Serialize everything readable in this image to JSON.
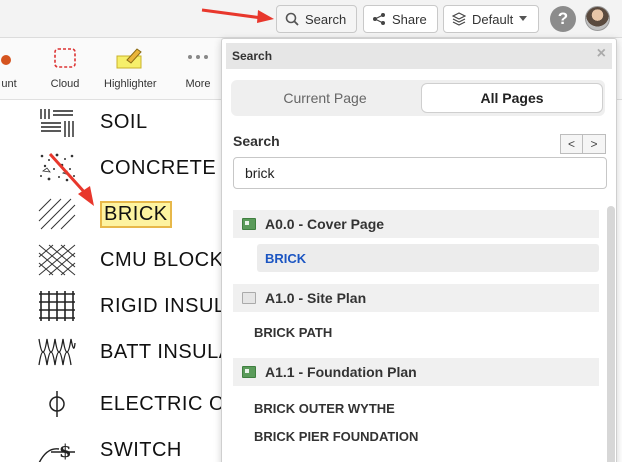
{
  "topbar": {
    "search_label": "Search",
    "share_label": "Share",
    "default_label": "Default",
    "help_label": "?"
  },
  "tools": [
    {
      "label": "unt",
      "icon": "count-icon"
    },
    {
      "label": "Cloud",
      "icon": "cloud-icon"
    },
    {
      "label": "Highlighter",
      "icon": "highlighter-icon"
    },
    {
      "label": "More",
      "icon": "more-icon"
    }
  ],
  "legend": {
    "items": [
      {
        "label": "SOIL",
        "icon": "soil-hatch-icon"
      },
      {
        "label": "CONCRETE",
        "icon": "concrete-hatch-icon"
      },
      {
        "label": "BRICK",
        "icon": "brick-hatch-icon"
      },
      {
        "label": "CMU BLOCK",
        "icon": "cmu-hatch-icon"
      },
      {
        "label": "RIGID INSUL",
        "icon": "rigid-insulation-icon"
      },
      {
        "label": "BATT INSULA",
        "icon": "batt-insulation-icon"
      },
      {
        "label": "ELECTRIC O",
        "icon": "electric-outlet-icon"
      },
      {
        "label": "SWITCH",
        "icon": "switch-icon"
      }
    ]
  },
  "panel": {
    "title": "Search",
    "close": "×",
    "tabs": {
      "current": "Current Page",
      "all": "All Pages"
    },
    "search_label": "Search",
    "prev": "<",
    "next": ">",
    "query": "brick",
    "results": [
      {
        "page": "A0.0 - Cover Page",
        "icon": "green",
        "matches": [
          "BRICK"
        ]
      },
      {
        "page": "A1.0 - Site Plan",
        "icon": "gray",
        "matches": [
          "BRICK PATH"
        ]
      },
      {
        "page": "A1.1 - Foundation Plan",
        "icon": "green",
        "matches": [
          "BRICK OUTER WYTHE",
          "BRICK PIER FOUNDATION"
        ]
      }
    ]
  },
  "colors": {
    "accent_blue": "#1b55c2",
    "highlight_yellow": "#fdf3a0",
    "arrow_red": "#e8372c"
  }
}
